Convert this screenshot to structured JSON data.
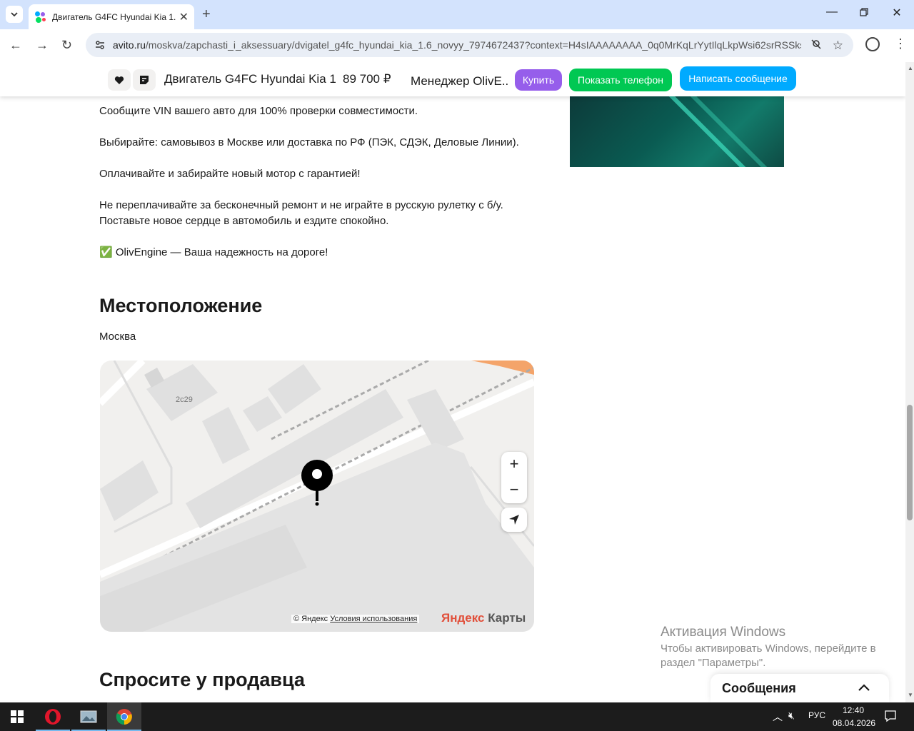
{
  "browser": {
    "tab_title": "Двигатель G4FC Hyundai Kia 1.",
    "url_host": "avito.ru",
    "url_path": "/moskva/zapchasti_i_aksessuary/dvigatel_g4fc_hyundai_kia_1.6_novyy_7974672437?context=H4sIAAAAAAAA_0q0MrKqLrYytIlqLkpWsi62srRSSkssyy..."
  },
  "sticky": {
    "title": "Двигатель G4FC Hyundai Kia 1...",
    "price": "89 700 ₽",
    "seller": "Менеджер OlivE...",
    "buy": "Купить",
    "show_phone": "Показать телефон",
    "write_message": "Написать сообщение"
  },
  "description": {
    "line1": "Сообщите VIN вашего авто для 100% проверки совместимости.",
    "line2": "Выбирайте: самовывоз в Москве или доставка по РФ (ПЭК, СДЭК, Деловые Линии).",
    "line3": "Оплачивайте и забирайте новый мотор с гарантией!",
    "line4a": "Не переплачивайте за бесконечный ремонт и не играйте в русскую рулетку с б/у.",
    "line4b": "Поставьте новое сердце в автомобиль и ездите спокойно.",
    "line5": "✅ OlivEngine — Ваша надежность на дороге!"
  },
  "location": {
    "heading": "Местоположение",
    "city": "Москва",
    "building_label": "2с29",
    "copyright": "© Яндекс",
    "terms": "Условия использования",
    "logo_y": "Яндекс",
    "logo_rest": " Карты",
    "zoom_in": "+",
    "zoom_out": "−"
  },
  "ask": {
    "heading": "Спросите у продавца"
  },
  "messages": {
    "label": "Сообщения"
  },
  "activation": {
    "title": "Активация Windows",
    "line1": "Чтобы активировать Windows, перейдите в",
    "line2": "раздел \"Параметры\"."
  },
  "taskbar": {
    "lang": "РУС",
    "time": "12:40",
    "date": "08.04.2026"
  },
  "colors": {
    "buy": "#965eeb",
    "phone": "#00c853",
    "message": "#00aaff"
  }
}
